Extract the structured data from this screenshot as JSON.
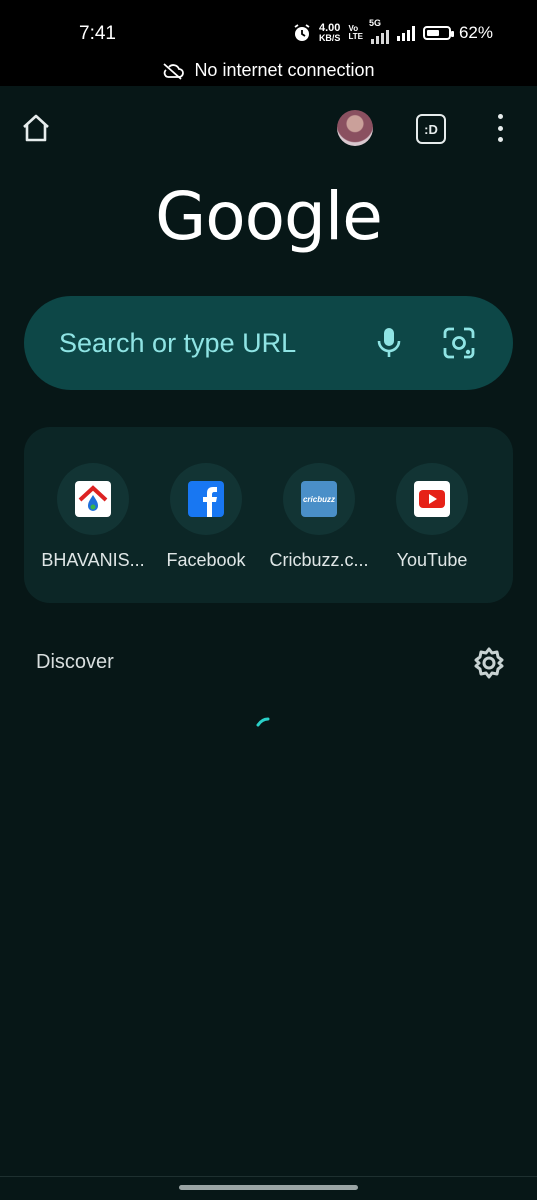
{
  "status_bar": {
    "time": "7:41",
    "net_speed_value": "4.00",
    "net_speed_unit": "KB/S",
    "volte_top": "Vo",
    "volte_bottom": "LTE",
    "network": "5G",
    "battery_percent": "62%",
    "battery_level": 0.62,
    "icons": [
      "alarm-icon",
      "signal-icon",
      "battery-icon"
    ]
  },
  "offline_banner": {
    "text": "No internet connection",
    "icon": "cloud-off-icon"
  },
  "toolbar": {
    "tabs_label": ":D",
    "icons": [
      "home-icon",
      "avatar",
      "tab-switcher-icon",
      "more-vert-icon"
    ]
  },
  "logo": {
    "text": "Google"
  },
  "search": {
    "placeholder": "Search or type URL",
    "icons": [
      "mic-icon",
      "lens-icon"
    ]
  },
  "shortcuts": [
    {
      "label": "BHAVANIS...",
      "icon": "bhavanis-favicon"
    },
    {
      "label": "Facebook",
      "icon": "facebook-favicon"
    },
    {
      "label": "Cricbuzz.c...",
      "icon": "cricbuzz-favicon",
      "favicon_text": "cricbuzz"
    },
    {
      "label": "YouTube",
      "icon": "youtube-favicon"
    }
  ],
  "discover": {
    "title": "Discover",
    "icon": "settings-gear-icon"
  },
  "colors": {
    "background": "#071717",
    "search_bg": "#0d4747",
    "accent": "#8fe4e4",
    "shortcut_panel": "#0c2626"
  }
}
